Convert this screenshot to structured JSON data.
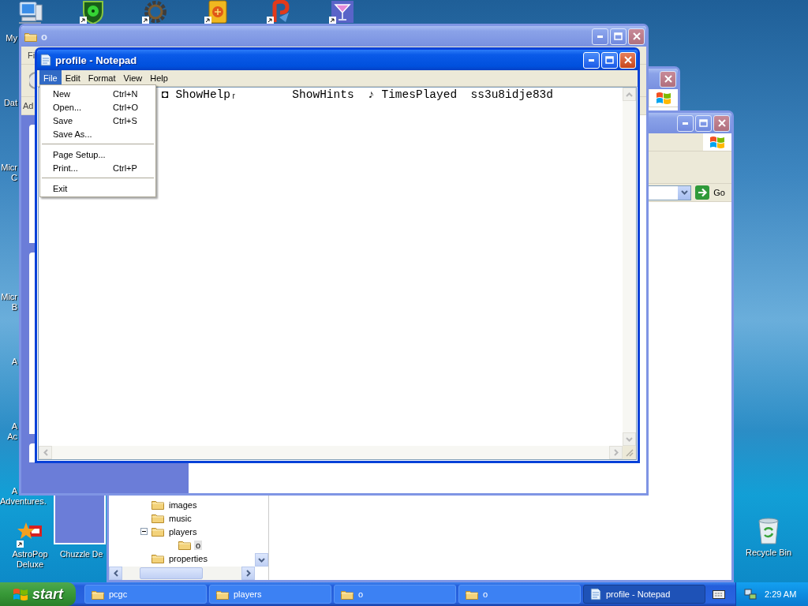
{
  "desktop": {
    "top_icons": [
      {
        "kind": "computer",
        "shortcut": false
      },
      {
        "kind": "shield",
        "shortcut": true
      },
      {
        "kind": "gear",
        "shortcut": true
      },
      {
        "kind": "tile",
        "shortcut": true
      },
      {
        "kind": "swirl",
        "shortcut": true
      },
      {
        "kind": "glass",
        "shortcut": true
      }
    ],
    "side_labels": [
      {
        "lines": [
          "My"
        ]
      },
      {
        "lines": [
          "Dat"
        ]
      },
      {
        "lines": [
          "Micr",
          "C"
        ]
      },
      {
        "lines": [
          "Micr",
          "B"
        ]
      },
      {
        "lines": [
          "A"
        ]
      },
      {
        "lines": [
          "A",
          "Ac"
        ]
      },
      {
        "lines": [
          "A",
          "Adventures."
        ]
      }
    ],
    "bottom_icons": [
      {
        "kind": "star",
        "lines": [
          "AstroPop",
          "Deluxe"
        ],
        "shortcut": true
      },
      {
        "kind": "none",
        "lines": [
          "Chuzzle De"
        ]
      }
    ],
    "recycle_bin": {
      "label": "Recycle Bin"
    }
  },
  "back_window": {
    "title": "o",
    "active": false,
    "menu_fragment": "Fi",
    "address_fragment": "Ad"
  },
  "middle_window": {
    "active": false
  },
  "explorer_window": {
    "active": false,
    "go_label": "Go",
    "tree": [
      {
        "label": "images",
        "selected": false
      },
      {
        "label": "music",
        "selected": false
      },
      {
        "label": "players",
        "selected": false,
        "expanded": true,
        "children": [
          {
            "label": "o",
            "selected": true
          }
        ]
      },
      {
        "label": "properties",
        "selected": false
      }
    ]
  },
  "notepad": {
    "title": "profile - Notepad",
    "active": true,
    "menu": [
      {
        "label": "File",
        "selected": true
      },
      {
        "label": "Edit",
        "selected": false
      },
      {
        "label": "Format",
        "selected": false
      },
      {
        "label": "View",
        "selected": false
      },
      {
        "label": "Help",
        "selected": false
      }
    ],
    "content": "◘ ShowHelpᵣ        ShowHints  ♪ TimesPlayed  ss3u8idje83d",
    "file_menu": [
      {
        "kind": "item",
        "label": "New",
        "shortcut": "Ctrl+N"
      },
      {
        "kind": "item",
        "label": "Open...",
        "shortcut": "Ctrl+O"
      },
      {
        "kind": "item",
        "label": "Save",
        "shortcut": "Ctrl+S"
      },
      {
        "kind": "item",
        "label": "Save As..."
      },
      {
        "kind": "separator"
      },
      {
        "kind": "item",
        "label": "Page Setup..."
      },
      {
        "kind": "item",
        "label": "Print...",
        "shortcut": "Ctrl+P"
      },
      {
        "kind": "separator"
      },
      {
        "kind": "item",
        "label": "Exit"
      }
    ]
  },
  "taskbar": {
    "start_label": "start",
    "tasks": [
      {
        "kind": "folder",
        "label": "pcgc",
        "selected": false
      },
      {
        "kind": "folder",
        "label": "players",
        "selected": false
      },
      {
        "kind": "folder",
        "label": "o",
        "selected": false
      },
      {
        "kind": "folder",
        "label": "o",
        "selected": false
      },
      {
        "kind": "notepad",
        "label": "profile - Notepad",
        "selected": true
      }
    ],
    "clock": "2:29 AM"
  }
}
